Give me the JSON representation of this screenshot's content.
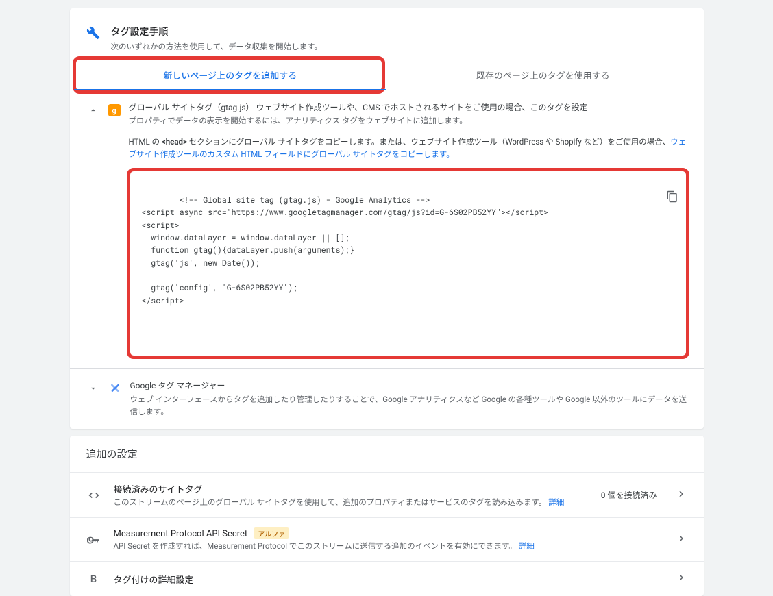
{
  "header": {
    "title": "タグ設定手順",
    "subtitle": "次のいずれかの方法を使用して、データ収集を開始します。"
  },
  "tabs": {
    "new": "新しいページ上のタグを追加する",
    "existing": "既存のページ上のタグを使用する"
  },
  "global_tag": {
    "title": "グローバル サイトタグ（gtag.js） ウェブサイト作成ツールや、CMS でホストされるサイトをご使用の場合、このタグを設定",
    "desc": "プロパティでデータの表示を開始するには、アナリティクス タグをウェブサイトに追加します。",
    "note_pre": "HTML の ",
    "note_head": "<head>",
    "note_mid": " セクションにグローバル サイトタグをコピーします。または、ウェブサイト作成ツール（WordPress や Shopify など）をご使用の場合、",
    "note_link": "ウェブサイト作成ツールのカスタム HTML フィールドにグローバル サイトタグをコピーします。",
    "code": "<!-- Global site tag (gtag.js) - Google Analytics -->\n<script async src=\"https://www.googletagmanager.com/gtag/js?id=G-6S02PB52YY\"></script>\n<script>\n  window.dataLayer = window.dataLayer || [];\n  function gtag(){dataLayer.push(arguments);}\n  gtag('js', new Date());\n\n  gtag('config', 'G-6S02PB52YY');\n</script>"
  },
  "gtm": {
    "title": "Google タグ マネージャー",
    "desc": "ウェブ インターフェースからタグを追加したり管理したりすることで、Google アナリティクスなど Google の各種ツールや Google 以外のツールにデータを送信します。"
  },
  "extra": {
    "heading": "追加の設定",
    "row1": {
      "title": "接続済みのサイトタグ",
      "sub_pre": "このストリームのページ上のグローバル サイトタグを使用して、追加のプロパティまたはサービスのタグを読み込みます。 ",
      "sub_link": "詳細",
      "trail": "0 個を接続済み"
    },
    "row2": {
      "title": "Measurement Protocol API Secret",
      "alpha": "アルファ",
      "sub_pre": "API Secret を作成すれば、Measurement Protocol でこのストリームに送信する追加のイベントを有効にできます。 ",
      "sub_link": "詳細"
    },
    "row3": {
      "title": "タグ付けの詳細設定"
    }
  }
}
